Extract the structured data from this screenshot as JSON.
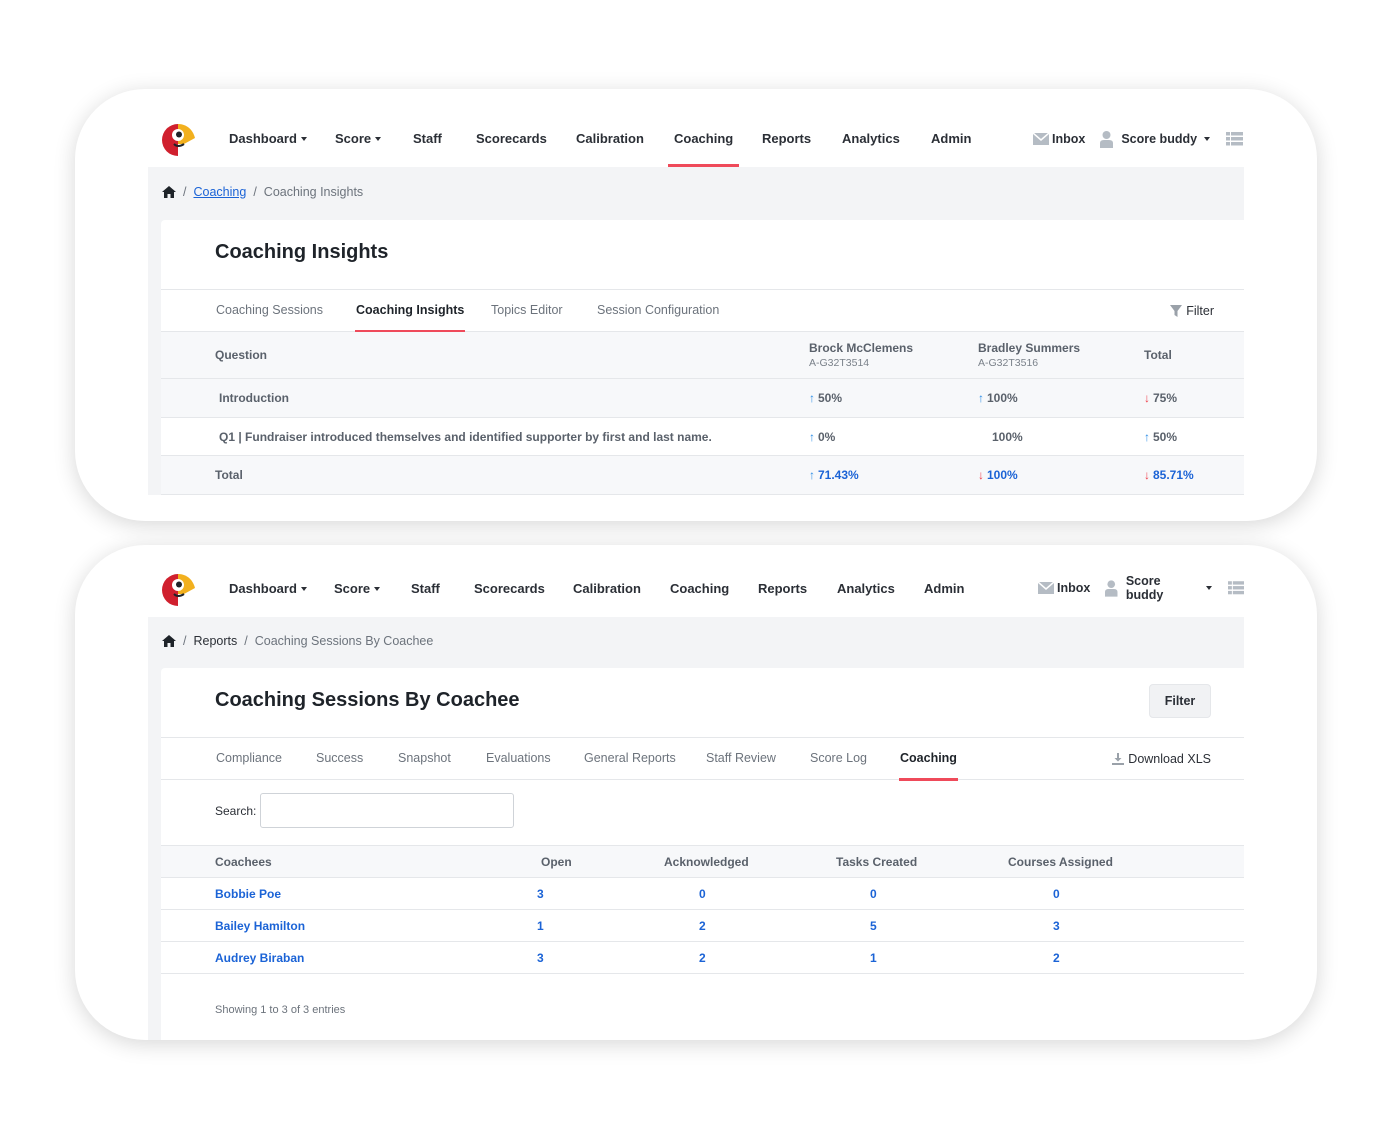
{
  "navbar": {
    "logo_alt": "Parrot logo",
    "items": [
      {
        "label": "Dashboard",
        "dropdown": true
      },
      {
        "label": "Score",
        "dropdown": true
      },
      {
        "label": "Staff",
        "dropdown": false
      },
      {
        "label": "Scorecards",
        "dropdown": false
      },
      {
        "label": "Calibration",
        "dropdown": false
      },
      {
        "label": "Coaching",
        "dropdown": false
      },
      {
        "label": "Reports",
        "dropdown": false
      },
      {
        "label": "Analytics",
        "dropdown": false
      },
      {
        "label": "Admin",
        "dropdown": false
      }
    ],
    "inbox_label": "Inbox",
    "user_label": "Score buddy",
    "icons": {
      "inbox": "envelope-icon",
      "user": "user-icon",
      "menu": "list-icon"
    }
  },
  "screen1": {
    "active_nav": "Coaching",
    "breadcrumb": {
      "home_icon": "home-icon",
      "link": "Coaching",
      "current": "Coaching Insights"
    },
    "title": "Coaching Insights",
    "tabs": [
      "Coaching Sessions",
      "Coaching Insights",
      "Topics Editor",
      "Session Configuration"
    ],
    "active_tab": "Coaching Insights",
    "filter_label": "Filter",
    "table": {
      "headers": {
        "question": "Question",
        "col1_name": "Brock McClemens",
        "col1_id": "A-G32T3514",
        "col2_name": "Bradley Summers",
        "col2_id": "A-G32T3516",
        "total": "Total"
      },
      "rows": [
        {
          "question": "Introduction",
          "c1": "50%",
          "c1_trend": "up",
          "c2": "100%",
          "c2_trend": "up",
          "total": "75%",
          "total_trend": "down"
        },
        {
          "question": "Q1 | Fundraiser introduced themselves and identified supporter by first and last name.",
          "c1": "0%",
          "c1_trend": "up",
          "c2": "100%",
          "c2_trend": "none",
          "total": "50%",
          "total_trend": "up"
        }
      ],
      "total_row": {
        "label": "Total",
        "c1": "71.43%",
        "c1_trend": "up",
        "c2": "100%",
        "c2_trend": "down",
        "total": "85.71%",
        "total_trend": "down"
      }
    }
  },
  "screen2": {
    "active_nav": "Coaching",
    "breadcrumb": {
      "home_icon": "home-icon",
      "link": "Reports",
      "current": "Coaching Sessions By Coachee"
    },
    "title": "Coaching Sessions By Coachee",
    "filter_button": "Filter",
    "tabs": [
      "Compliance",
      "Success",
      "Snapshot",
      "Evaluations",
      "General Reports",
      "Staff Review",
      "Score Log",
      "Coaching"
    ],
    "active_tab": "Coaching",
    "download_label": "Download XLS",
    "search_label": "Search:",
    "search_value": "",
    "table": {
      "headers": [
        "Coachees",
        "Open",
        "Acknowledged",
        "Tasks Created",
        "Courses Assigned"
      ],
      "rows": [
        {
          "name": "Bobbie Poe",
          "open": "3",
          "acknowledged": "0",
          "tasks": "0",
          "courses": "0"
        },
        {
          "name": "Bailey Hamilton",
          "open": "1",
          "acknowledged": "2",
          "tasks": "5",
          "courses": "3"
        },
        {
          "name": "Audrey Biraban",
          "open": "3",
          "acknowledged": "2",
          "tasks": "1",
          "courses": "2"
        }
      ]
    },
    "showing": "Showing 1 to 3 of 3 entries"
  },
  "colors": {
    "accent_red": "#ef4a5a",
    "link_blue": "#1b63d6",
    "trend_up": "#2d8ee6",
    "trend_down": "#ef3e4a"
  }
}
